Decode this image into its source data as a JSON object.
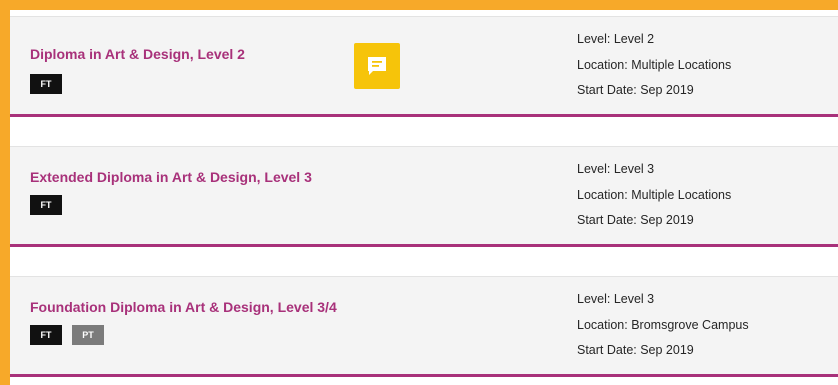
{
  "courses": [
    {
      "title": "Diploma in Art & Design, Level 2",
      "tags": [
        "FT"
      ],
      "level": "Level: Level 2",
      "location": "Location: Multiple Locations",
      "start_date": "Start Date: Sep 2019"
    },
    {
      "title": "Extended Diploma in Art & Design, Level 3",
      "tags": [
        "FT"
      ],
      "level": "Level: Level 3",
      "location": "Location: Multiple Locations",
      "start_date": "Start Date: Sep 2019"
    },
    {
      "title": "Foundation Diploma in Art & Design, Level 3/4",
      "tags": [
        "FT",
        "PT"
      ],
      "level": "Level: Level 3",
      "location": "Location: Bromsgrove Campus",
      "start_date": "Start Date: Sep 2019"
    }
  ],
  "colors": {
    "accent": "#a8317a",
    "frame": "#f7a929",
    "chat": "#f6c40a"
  },
  "chat_icon": "chat-bubble-icon"
}
